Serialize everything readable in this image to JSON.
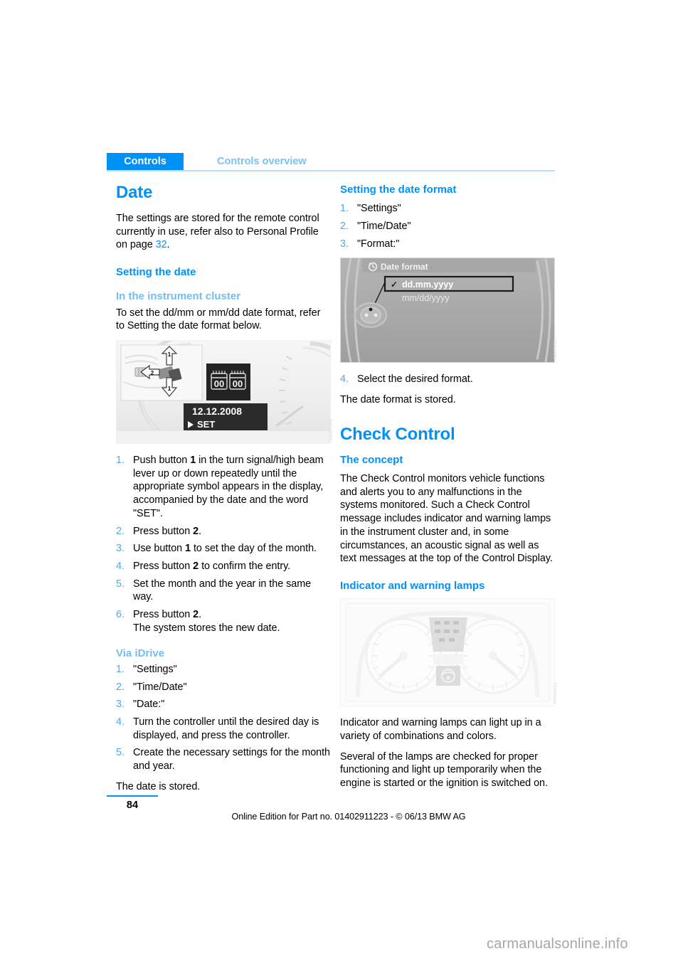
{
  "header": {
    "chapter": "Controls",
    "section": "Controls overview"
  },
  "left_column": {
    "title": "Date",
    "intro_1": "The settings are stored for the remote control currently in use, refer also to Personal Profile on page ",
    "intro_page_ref": "32",
    "intro_2": ".",
    "setting_the_date_heading": "Setting the date",
    "instrument_cluster_heading": "In the instrument cluster",
    "instrument_cluster_intro": "To set the dd/mm or mm/dd date format, refer to Setting the date format below.",
    "figure_cluster_date": {
      "name": "instrument-cluster-date-setting",
      "callout_1": "1",
      "callout_2": "2",
      "display_date": "12.12.2008",
      "display_set": "SET",
      "code": "BMW0209"
    },
    "steps": [
      {
        "num": "1.",
        "parts": [
          {
            "t": "Push button ",
            "b": false
          },
          {
            "t": "1",
            "b": true
          },
          {
            "t": " in the turn signal/high beam lever up or down repeatedly until the appropriate symbol appears in the display, accompanied by the date and the word \"SET\".",
            "b": false
          }
        ]
      },
      {
        "num": "2.",
        "parts": [
          {
            "t": "Press button ",
            "b": false
          },
          {
            "t": "2",
            "b": true
          },
          {
            "t": ".",
            "b": false
          }
        ]
      },
      {
        "num": "3.",
        "parts": [
          {
            "t": "Use button ",
            "b": false
          },
          {
            "t": "1",
            "b": true
          },
          {
            "t": " to set the day of the month.",
            "b": false
          }
        ]
      },
      {
        "num": "4.",
        "parts": [
          {
            "t": "Press button ",
            "b": false
          },
          {
            "t": "2",
            "b": true
          },
          {
            "t": " to confirm the entry.",
            "b": false
          }
        ]
      },
      {
        "num": "5.",
        "parts": [
          {
            "t": "Set the month and the year in the same way.",
            "b": false
          }
        ]
      },
      {
        "num": "6.",
        "parts": [
          {
            "t": "Press button ",
            "b": false
          },
          {
            "t": "2",
            "b": true
          },
          {
            "t": ".",
            "b": false
          }
        ],
        "sub": "The system stores the new date."
      }
    ],
    "via_idrive_heading": "Via iDrive",
    "idrive_steps": [
      {
        "num": "1.",
        "parts": [
          {
            "t": "\"Settings\"",
            "b": false
          }
        ]
      },
      {
        "num": "2.",
        "parts": [
          {
            "t": "\"Time/Date\"",
            "b": false
          }
        ]
      },
      {
        "num": "3.",
        "parts": [
          {
            "t": "\"Date:\"",
            "b": false
          }
        ]
      },
      {
        "num": "4.",
        "parts": [
          {
            "t": "Turn the controller until the desired day is displayed, and press the controller.",
            "b": false
          }
        ]
      },
      {
        "num": "5.",
        "parts": [
          {
            "t": "Create the necessary settings for the month and year.",
            "b": false
          }
        ]
      }
    ],
    "date_stored": "The date is stored."
  },
  "right_column": {
    "date_format_heading": "Setting the date format",
    "format_steps": [
      {
        "num": "1.",
        "parts": [
          {
            "t": "\"Settings\"",
            "b": false
          }
        ]
      },
      {
        "num": "2.",
        "parts": [
          {
            "t": "\"Time/Date\"",
            "b": false
          }
        ]
      },
      {
        "num": "3.",
        "parts": [
          {
            "t": "\"Format:\"",
            "b": false
          }
        ]
      }
    ],
    "figure_idrive": {
      "name": "idrive-date-format-menu",
      "menu_title": "Date format",
      "option_selected": "dd.mm.yyyy",
      "option_other": "mm/dd/yyyy",
      "check_glyph": "✓",
      "code": "BMW0210"
    },
    "format_step_4": {
      "num": "4.",
      "parts": [
        {
          "t": "Select the desired format.",
          "b": false
        }
      ]
    },
    "format_stored": "The date format is stored.",
    "check_control_title": "Check Control",
    "concept_heading": "The concept",
    "concept_body": "The Check Control monitors vehicle functions and alerts you to any malfunctions in the systems monitored. Such a Check Control message includes indicator and warning lamps in the instrument cluster and, in some circumstances, an acoustic signal as well as text messages at the top of the Control Display.",
    "lamps_heading": "Indicator and warning lamps",
    "figure_lamps": {
      "name": "instrument-cluster-indicator-lamps",
      "code": "BMW0211"
    },
    "lamps_body_1": "Indicator and warning lamps can light up in a variety of combinations and colors.",
    "lamps_body_2": "Several of the lamps are checked for proper functioning and light up temporarily when the engine is started or the ignition is switched on."
  },
  "footer": {
    "page_number": "84",
    "note": "Online Edition for Part no. 01402911223 - © 06/13 BMW AG",
    "watermark": "carmanualsonline.info"
  },
  "colors": {
    "accent_blue": "#0091f7",
    "light_blue": "#74bdf2",
    "header_band": "#0091f7"
  }
}
